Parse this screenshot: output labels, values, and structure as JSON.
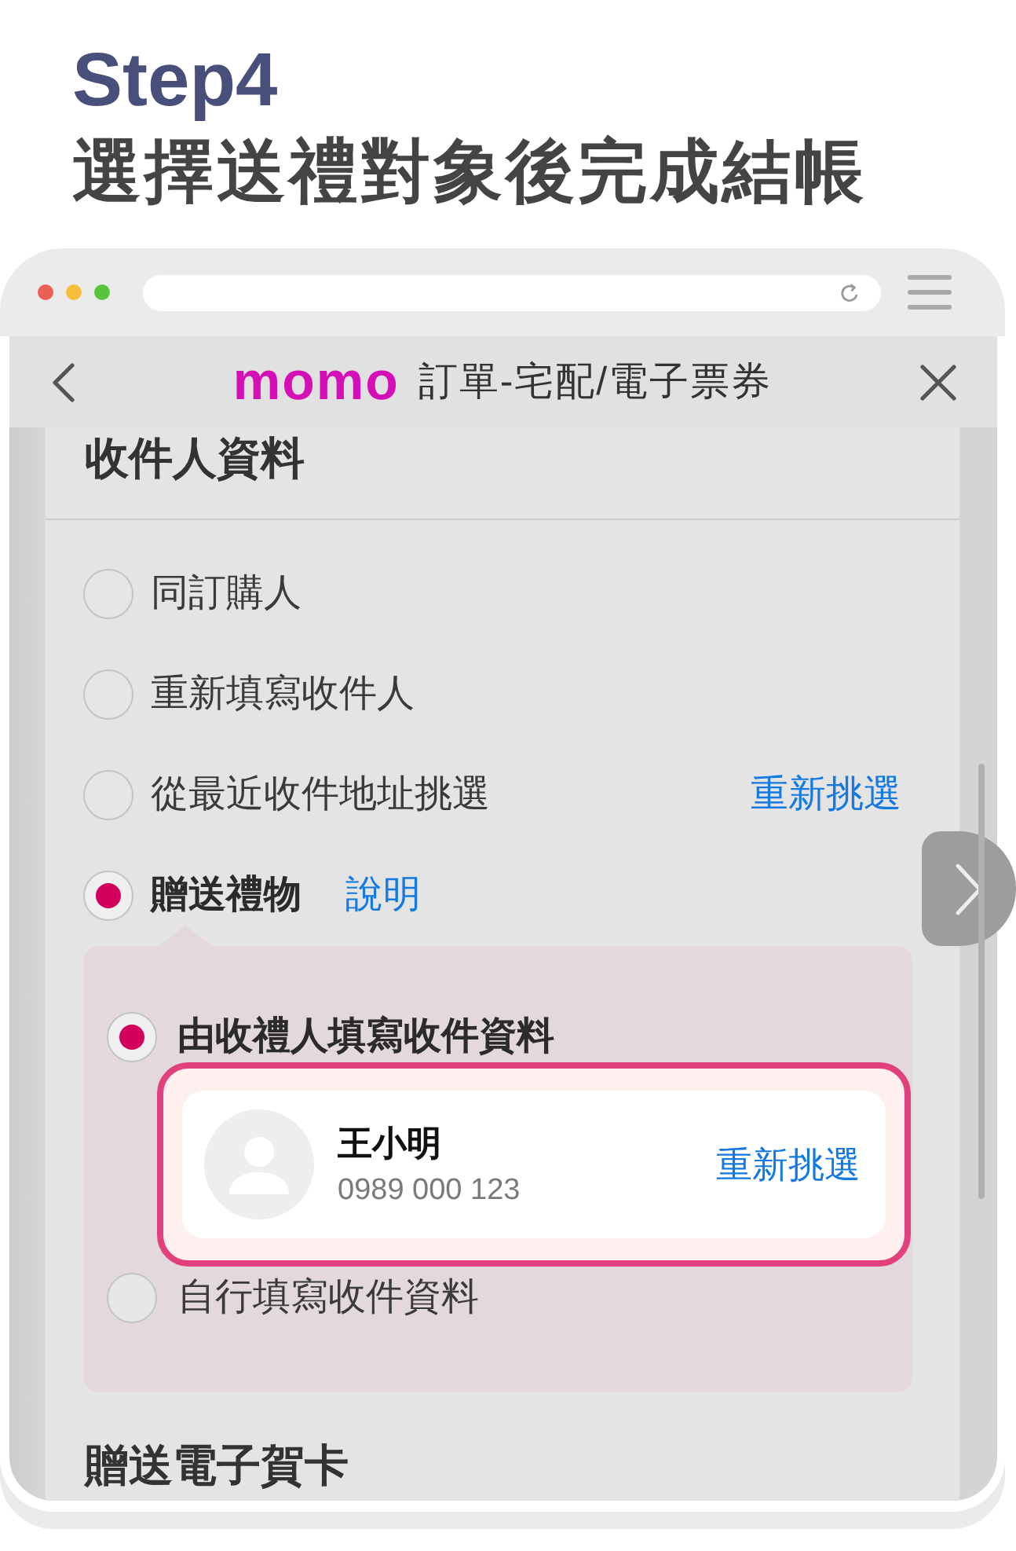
{
  "heading": {
    "step": "Step4",
    "title": "選擇送禮對象後完成結帳"
  },
  "header": {
    "logo": "momo",
    "title": "訂單-宅配/電子票券"
  },
  "section": {
    "title": "收件人資料",
    "options": [
      {
        "label": "同訂購人",
        "selected": false
      },
      {
        "label": "重新填寫收件人",
        "selected": false
      },
      {
        "label": "從最近收件地址挑選",
        "selected": false,
        "action": "重新挑選"
      },
      {
        "label": "贈送禮物",
        "selected": true,
        "help_link": "說明"
      }
    ],
    "gift_panel": {
      "options": [
        {
          "label": "由收禮人填寫收件資料",
          "selected": true,
          "recipient": {
            "name": "王小明",
            "phone": "0989 000 123",
            "action": "重新挑選"
          }
        },
        {
          "label": "自行填寫收件資料",
          "selected": false
        }
      ]
    }
  },
  "next_section": {
    "title": "贈送電子賀卡"
  }
}
